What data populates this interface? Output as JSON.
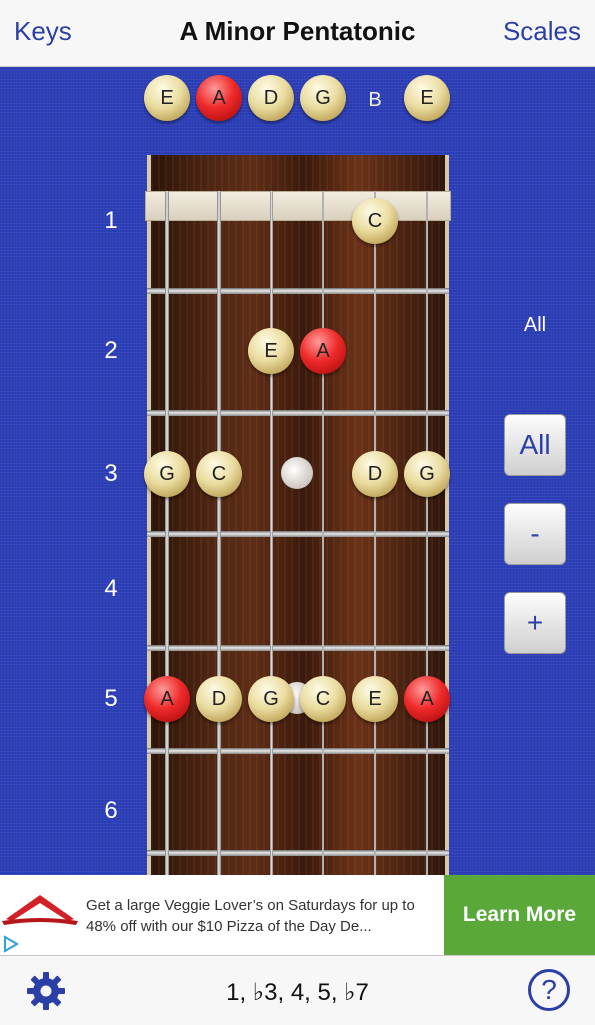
{
  "nav": {
    "left": "Keys",
    "title": "A Minor Pentatonic",
    "right": "Scales"
  },
  "open_notes": [
    {
      "label": "E",
      "style": "gold"
    },
    {
      "label": "A",
      "style": "red"
    },
    {
      "label": "D",
      "style": "gold"
    },
    {
      "label": "G",
      "style": "gold"
    },
    {
      "label": "B",
      "style": "none"
    },
    {
      "label": "E",
      "style": "gold"
    }
  ],
  "fret_numbers": [
    "1",
    "2",
    "3",
    "4",
    "5",
    "6"
  ],
  "fret_notes": [
    {
      "fret": 1,
      "string": 5,
      "label": "C",
      "style": "gold"
    },
    {
      "fret": 2,
      "string": 3,
      "label": "E",
      "style": "gold"
    },
    {
      "fret": 2,
      "string": 4,
      "label": "A",
      "style": "red"
    },
    {
      "fret": 3,
      "string": 1,
      "label": "G",
      "style": "gold"
    },
    {
      "fret": 3,
      "string": 2,
      "label": "C",
      "style": "gold"
    },
    {
      "fret": 3,
      "string": 5,
      "label": "D",
      "style": "gold"
    },
    {
      "fret": 3,
      "string": 6,
      "label": "G",
      "style": "gold"
    },
    {
      "fret": 5,
      "string": 1,
      "label": "A",
      "style": "red"
    },
    {
      "fret": 5,
      "string": 2,
      "label": "D",
      "style": "gold"
    },
    {
      "fret": 5,
      "string": 3,
      "label": "G",
      "style": "gold"
    },
    {
      "fret": 5,
      "string": 4,
      "label": "C",
      "style": "gold"
    },
    {
      "fret": 5,
      "string": 5,
      "label": "E",
      "style": "gold"
    },
    {
      "fret": 5,
      "string": 6,
      "label": "A",
      "style": "red"
    }
  ],
  "side": {
    "label": "All",
    "btn_all": "All",
    "btn_minus": "-",
    "btn_plus": "+"
  },
  "ad": {
    "text": "Get a large Veggie Lover’s on Saturdays for up to 48% off with our $10 Pizza of the Day De...",
    "cta": "Learn More"
  },
  "tabbar": {
    "formula": "1, ♭3, 4, 5, ♭7"
  },
  "colors": {
    "background": "#2d3fb8",
    "accent": "#2b3fa6",
    "root_note": "#ef2a2a",
    "note": "#eadca0",
    "cta": "#5aa83a"
  },
  "icons": [
    "gear-icon",
    "help-icon",
    "adchoices-icon",
    "pizza-hut-logo"
  ]
}
